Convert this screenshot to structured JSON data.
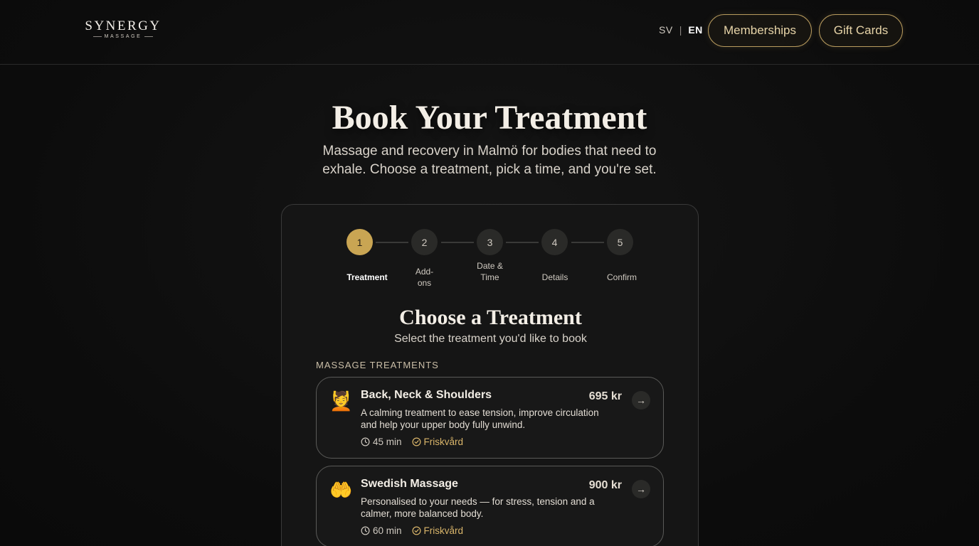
{
  "header": {
    "logo_main": "SYNERGY",
    "logo_sub": "MASSAGE",
    "lang_sv": "SV",
    "lang_sep": "|",
    "lang_en": "EN",
    "memberships_label": "Memberships",
    "giftcards_label": "Gift Cards"
  },
  "hero": {
    "title": "Book Your Treatment",
    "subtitle": "Massage and recovery in Malmö for bodies that need to exhale. Choose a treatment, pick a time, and you're set."
  },
  "steps": [
    {
      "number": "1",
      "label": "Treatment"
    },
    {
      "number": "2",
      "label": "Add-ons"
    },
    {
      "number": "3",
      "label": "Date & Time"
    },
    {
      "number": "4",
      "label": "Details"
    },
    {
      "number": "5",
      "label": "Confirm"
    }
  ],
  "section": {
    "title": "Choose a Treatment",
    "subtitle": "Select the treatment you'd like to book",
    "category": "MASSAGE TREATMENTS"
  },
  "treatments": [
    {
      "emoji": "💆",
      "name": "Back, Neck & Shoulders",
      "price": "695 kr",
      "description": "A calming treatment to ease tension, improve circulation and help your upper body fully unwind.",
      "duration": "45 min",
      "tag": "Friskvård"
    },
    {
      "emoji": "🤲",
      "name": "Swedish Massage",
      "price": "900 kr",
      "description": "Personalised to your needs — for stress, tension and a calmer, more balanced body.",
      "duration": "60 min",
      "tag": "Friskvård"
    }
  ],
  "colors": {
    "accent_gold": "#c9a553",
    "tag_gold": "#d9b56a",
    "background": "#0c0c0c"
  }
}
